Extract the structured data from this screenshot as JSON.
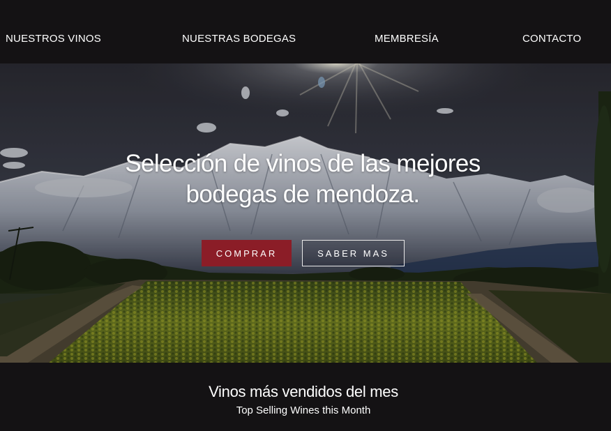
{
  "nav": {
    "items": [
      {
        "label": "NUESTROS VINOS"
      },
      {
        "label": "NUESTRAS BODEGAS"
      },
      {
        "label": "MEMBRESÍA"
      },
      {
        "label": "CONTACTO"
      }
    ]
  },
  "hero": {
    "title_line1": "Selección de vinos de las mejores",
    "title_line2": "bodegas de mendoza.",
    "buy_label": "COMPRAR",
    "more_label": "SABER MAS",
    "image": "mountain-vineyard-landscape"
  },
  "section": {
    "title": "Vinos más vendidos del mes",
    "subtitle": "Top Selling Wines this Month"
  },
  "colors": {
    "background": "#141214",
    "accent": "#8b1d27",
    "text": "#ffffff"
  }
}
